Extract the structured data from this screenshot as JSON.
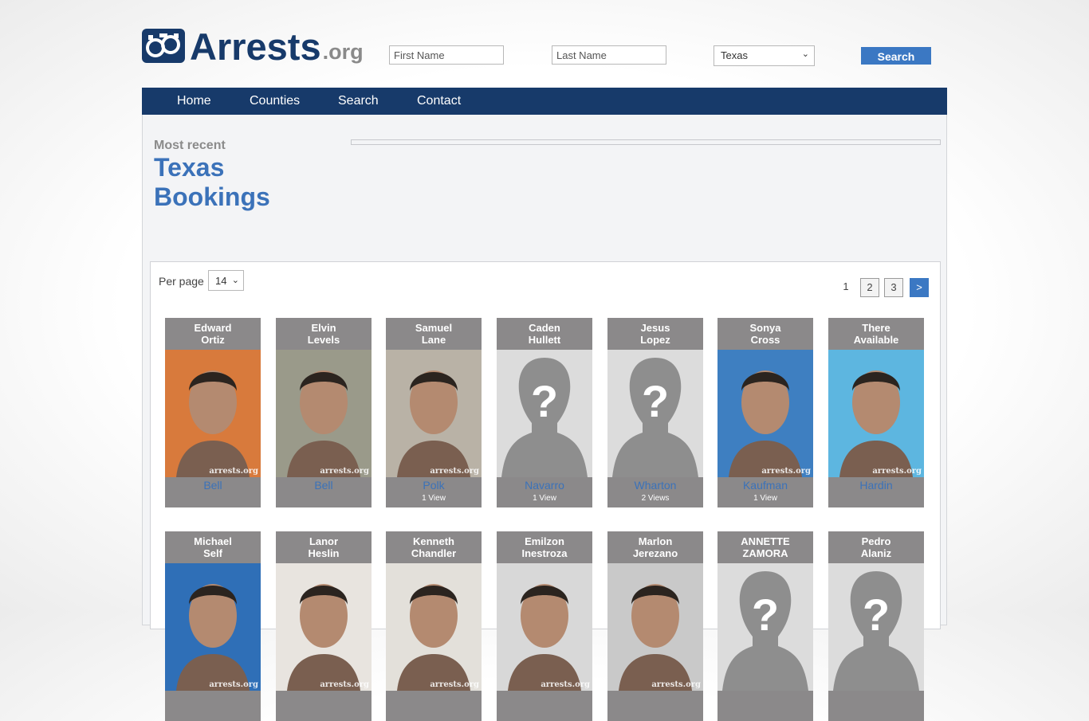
{
  "header": {
    "logo_main": "Arrests",
    "logo_suffix": ".org",
    "first_name_placeholder": "First Name",
    "last_name_placeholder": "Last Name",
    "state_selected": "Texas",
    "search_label": "Search"
  },
  "nav": [
    "Home",
    "Counties",
    "Search",
    "Contact"
  ],
  "page": {
    "most_recent": "Most recent",
    "title_line1": "Texas",
    "title_line2": "Bookings"
  },
  "listing": {
    "per_page_label": "Per page",
    "per_page_value": "14",
    "pages": [
      "1",
      "2",
      "3"
    ],
    "next_label": ">"
  },
  "bookings_row1": [
    {
      "first": "Edward",
      "last": "Ortiz",
      "county": "Bell",
      "views": "",
      "photo": "mugshot",
      "bg": "#d87a3c"
    },
    {
      "first": "Elvin",
      "last": "Levels",
      "county": "Bell",
      "views": "",
      "photo": "mugshot",
      "bg": "#9a9a8a"
    },
    {
      "first": "Samuel",
      "last": "Lane",
      "county": "Polk",
      "views": "1 View",
      "photo": "mugshot",
      "bg": "#b9b2a6"
    },
    {
      "first": "Caden",
      "last": "Hullett",
      "county": "Navarro",
      "views": "1 View",
      "photo": "placeholder",
      "bg": "#dcdcdc"
    },
    {
      "first": "Jesus",
      "last": "Lopez",
      "county": "Wharton",
      "views": "2 Views",
      "photo": "placeholder",
      "bg": "#dcdcdc"
    },
    {
      "first": "Sonya",
      "last": "Cross",
      "county": "Kaufman",
      "views": "1 View",
      "photo": "mugshot",
      "bg": "#3e7fc1"
    },
    {
      "first": "There",
      "last": "Available",
      "county": "Hardin",
      "views": "",
      "photo": "mugshot",
      "bg": "#5db6e0"
    }
  ],
  "bookings_row2": [
    {
      "first": "Michael",
      "last": "Self",
      "photo": "mugshot",
      "bg": "#2f6fb7"
    },
    {
      "first": "Lanor",
      "last": "Heslin",
      "photo": "mugshot",
      "bg": "#e8e4df"
    },
    {
      "first": "Kenneth",
      "last": "Chandler",
      "photo": "mugshot",
      "bg": "#e3e0da"
    },
    {
      "first": "Emilzon",
      "last": "Inestroza",
      "photo": "mugshot",
      "bg": "#d8d8d8"
    },
    {
      "first": "Marlon",
      "last": "Jerezano",
      "photo": "mugshot",
      "bg": "#c9c9c9"
    },
    {
      "first": "ANNETTE",
      "last": "ZAMORA",
      "photo": "placeholder",
      "bg": "#dcdcdc"
    },
    {
      "first": "Pedro",
      "last": "Alaniz",
      "photo": "placeholder",
      "bg": "#dcdcdc"
    }
  ],
  "watermark": "arrests.org",
  "colors": {
    "navy": "#173a6a",
    "accent": "#3b78c3",
    "card": "#8b898a"
  }
}
